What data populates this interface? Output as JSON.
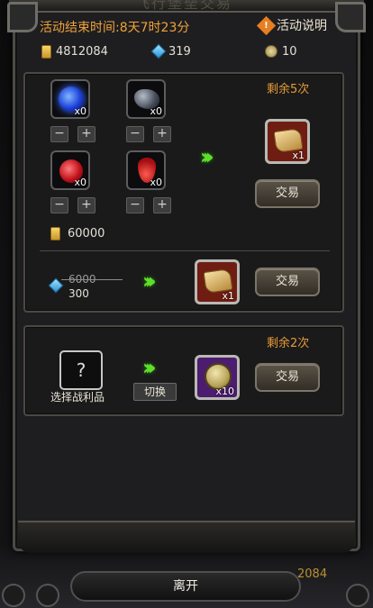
{
  "header": {
    "title": "飞行堡垒交易",
    "countdown": "活动结束时间:8天7时23分",
    "help_label": "活动说明"
  },
  "resources": {
    "gold": "4812084",
    "crystal": "319",
    "coin": "10"
  },
  "trade1": {
    "remaining": "剩余5次",
    "materials": [
      {
        "icon": "blue-orb-icon",
        "qty": "x0"
      },
      {
        "icon": "dark-ore-icon",
        "qty": "x0"
      },
      {
        "icon": "red-berry-icon",
        "qty": "x0"
      },
      {
        "icon": "red-drop-icon",
        "qty": "x0"
      }
    ],
    "stepper_minus": "−",
    "stepper_plus": "+",
    "reward_qty": "x1",
    "trade_label": "交易",
    "gold_cost": "60000"
  },
  "trade2": {
    "old_price": "6000",
    "new_price": "300",
    "reward_qty": "x1",
    "trade_label": "交易"
  },
  "trade3": {
    "remaining": "剩余2次",
    "mystery_symbol": "?",
    "choose_label": "选择战利品",
    "switch_label": "切换",
    "reward_qty": "x10",
    "trade_label": "交易"
  },
  "footer": {
    "leave_label": "离开",
    "bg_coin_label": "2084"
  },
  "colors": {
    "accent": "#f0a23a",
    "arrow": "#5fe02b"
  }
}
